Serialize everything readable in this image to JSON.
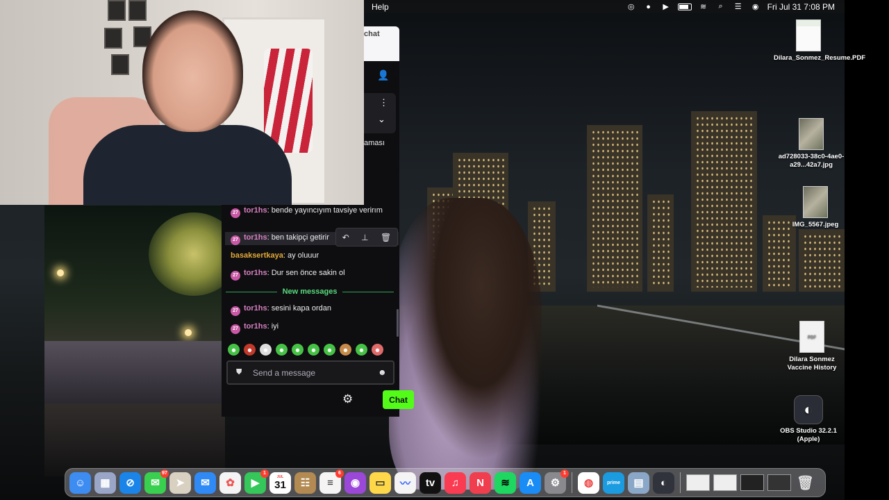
{
  "menubar": {
    "menu": "Help",
    "clock": "Fri Jul 31  7:08 PM"
  },
  "stream_panel": {
    "chat_label": "chat",
    "stub_text": "aması"
  },
  "chat": {
    "messages": [
      {
        "user": "tor1hs",
        "text": ": bende yayıncıyım tavsiye verirım",
        "badge": "27"
      },
      {
        "user": "tor1hs",
        "text": ": ben takipçi getirir",
        "badge": "27"
      },
      {
        "user": "basaksertkaya",
        "text": ": ay oluuur",
        "badge": ""
      },
      {
        "user": "tor1hs",
        "text": ": Dur sen önce sakin ol",
        "badge": "27"
      },
      {
        "user": "tor1hs",
        "text": ": sesini kapa ordan",
        "badge": "27"
      },
      {
        "user": "tor1hs",
        "text": ": iyi",
        "badge": "27"
      }
    ],
    "new_messages_label": "New messages",
    "input_placeholder": "Send a message",
    "send_label": "Chat",
    "accent": "#53fc18"
  },
  "desktop_icons": [
    {
      "label": "Dilara_Sonmez_Resume.PDF"
    },
    {
      "label": "ad728033-38c0-4ae0-a29...42a7.jpg"
    },
    {
      "label": "IMG_5567.jpeg"
    },
    {
      "label": "Dilara Sonmez Vaccine History"
    },
    {
      "label": "OBS Studio 32.2.1 (Apple)"
    }
  ],
  "dock": {
    "messages_badge": "97",
    "facetime_badge": "1",
    "calendar_day": "31",
    "calendar_month": "JUL",
    "reminders_badge": "6",
    "settings_badge": "1"
  }
}
